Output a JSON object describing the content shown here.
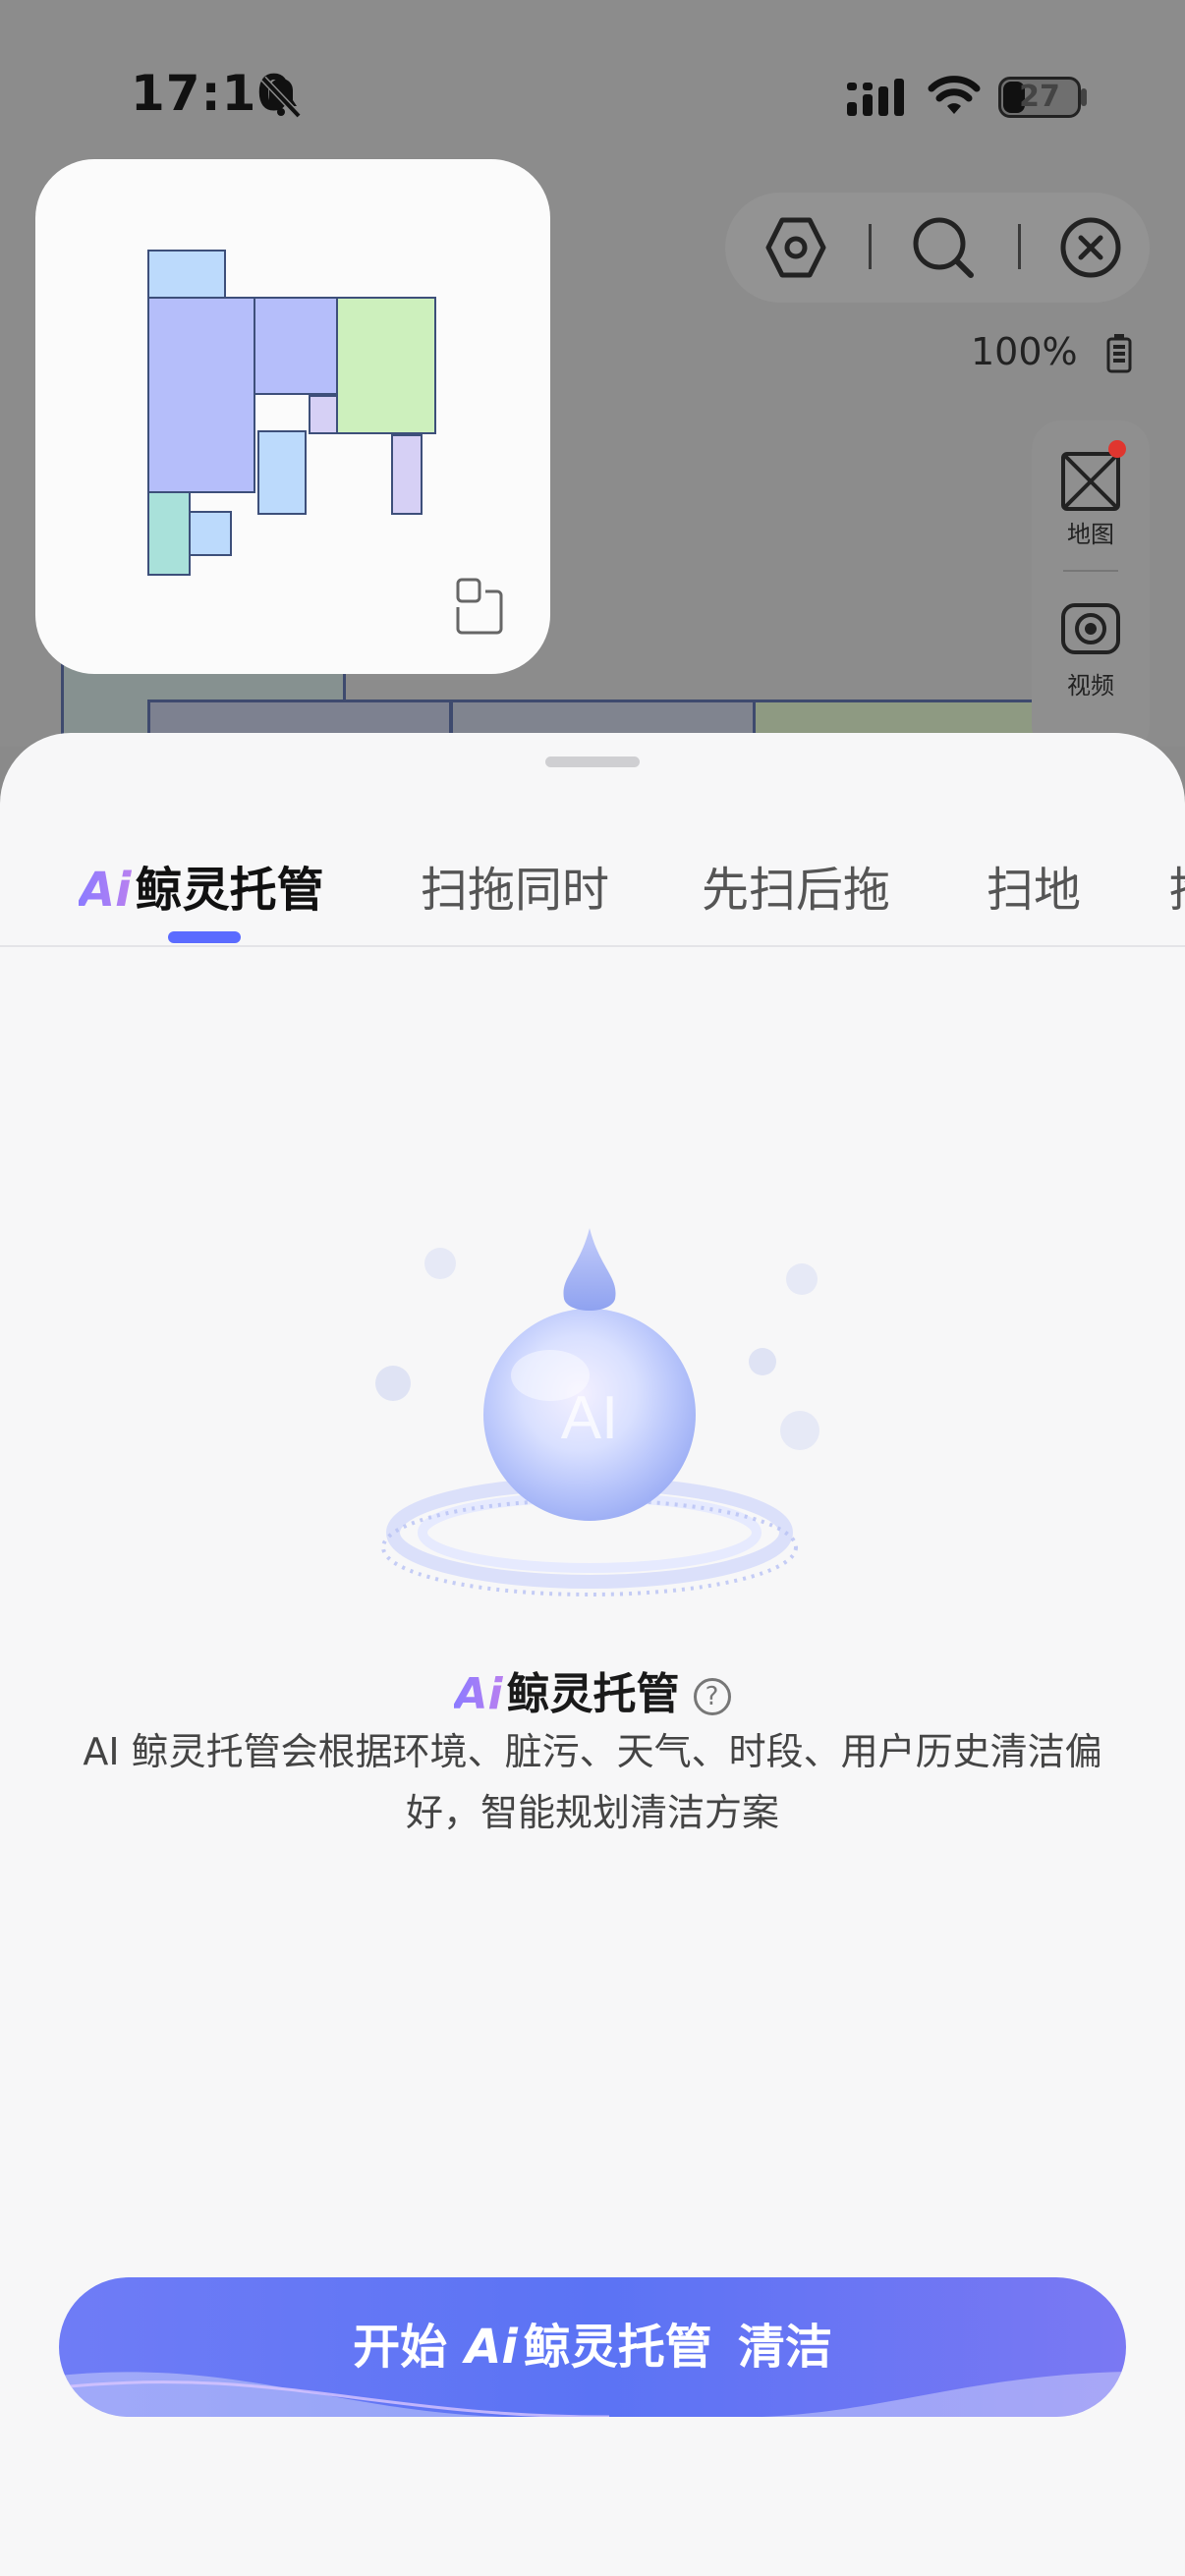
{
  "status_bar": {
    "time": "17:10",
    "battery_level": "27"
  },
  "map_panel": {
    "battery_percent": "100%",
    "side_items": [
      {
        "label": "地图",
        "icon": "map-icon"
      },
      {
        "label": "视频",
        "icon": "video-camera-icon"
      }
    ]
  },
  "tabs": [
    {
      "prefix": "Ai",
      "label": "鲸灵托管",
      "active": true
    },
    {
      "label": "扫拖同时",
      "active": false
    },
    {
      "label": "先扫后拖",
      "active": false
    },
    {
      "label": "扫地",
      "active": false
    },
    {
      "label": "拖",
      "active": false
    }
  ],
  "feature": {
    "ai_prefix": "Ai",
    "title": "鲸灵托管",
    "illustration_text": "AI",
    "description": "AI 鲸灵托管会根据环境、脏污、天气、时段、用户历史清洁偏好，智能规划清洁方案"
  },
  "start_button": {
    "prefix": "开始",
    "ai": "Ai",
    "name": "鲸灵托管",
    "suffix": "清洁"
  },
  "colors": {
    "accent": "#5b6bff",
    "button_gradient_start": "#6f7cf6",
    "button_gradient_end": "#7a78f3",
    "room_blue": "#b5befa",
    "room_green": "#cdf0bd",
    "room_light_blue": "#bcdafc",
    "room_teal": "#a9e1da",
    "room_lavender": "#d6d0f5"
  }
}
